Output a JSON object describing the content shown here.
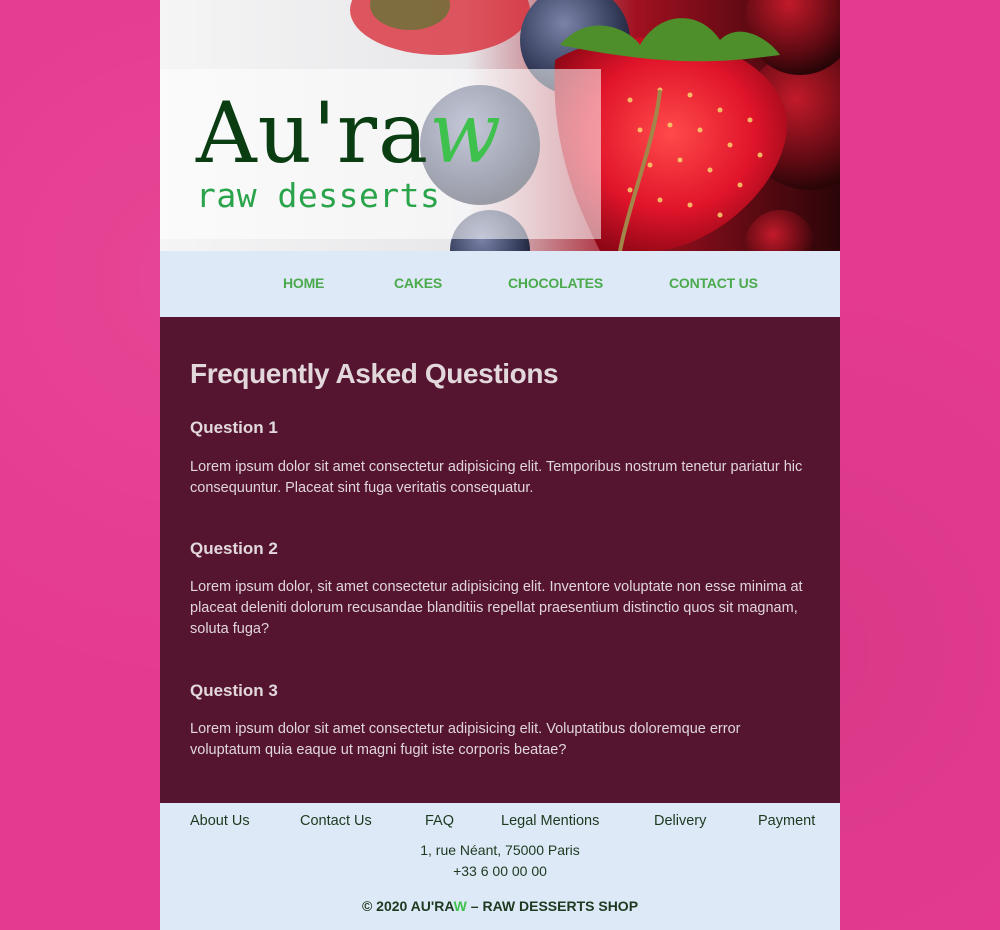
{
  "colors": {
    "page_background": "#e53b8f",
    "nav_background": "#dde9f6",
    "content_background": "#551530",
    "nav_link": "#4ba94e",
    "logo_dark": "#0a3d12",
    "logo_accent": "#3fc14e",
    "tagline": "#2aa44a",
    "footer_text": "#1d3a20"
  },
  "header": {
    "logo_main": "Au'ra",
    "logo_accent": "w",
    "tagline": "raw desserts",
    "image_subject": "strawberries, blueberries and cherries"
  },
  "nav": {
    "items": [
      {
        "label": "HOME"
      },
      {
        "label": "CAKES"
      },
      {
        "label": "CHOCOLATES"
      },
      {
        "label": "CONTACT US"
      }
    ]
  },
  "main": {
    "title": "Frequently Asked Questions",
    "questions": [
      {
        "title": "Question 1",
        "body": "Lorem ipsum dolor sit amet consectetur adipisicing elit. Temporibus nostrum tenetur pariatur hic consequuntur. Placeat sint fuga veritatis consequatur."
      },
      {
        "title": "Question 2",
        "body": "Lorem ipsum dolor, sit amet consectetur adipisicing elit. Inventore voluptate non esse minima at placeat deleniti dolorum recusandae blanditiis repellat praesentium distinctio quos sit magnam, soluta fuga?"
      },
      {
        "title": "Question 3",
        "body": "Lorem ipsum dolor sit amet consectetur adipisicing elit. Voluptatibus doloremque error voluptatum quia eaque ut magni fugit iste corporis beatae?"
      }
    ]
  },
  "footer": {
    "links": [
      {
        "label": "About Us"
      },
      {
        "label": "Contact Us"
      },
      {
        "label": "FAQ"
      },
      {
        "label": "Legal Mentions"
      },
      {
        "label": "Delivery"
      },
      {
        "label": "Payment"
      }
    ],
    "address": "1, rue Néant, 75000 Paris",
    "phone": "+33 6 00 00 00",
    "copyright_prefix": "© 2020 AU'RA",
    "copyright_accent": "W",
    "copyright_suffix": " – RAW DESSERTS SHOP"
  }
}
